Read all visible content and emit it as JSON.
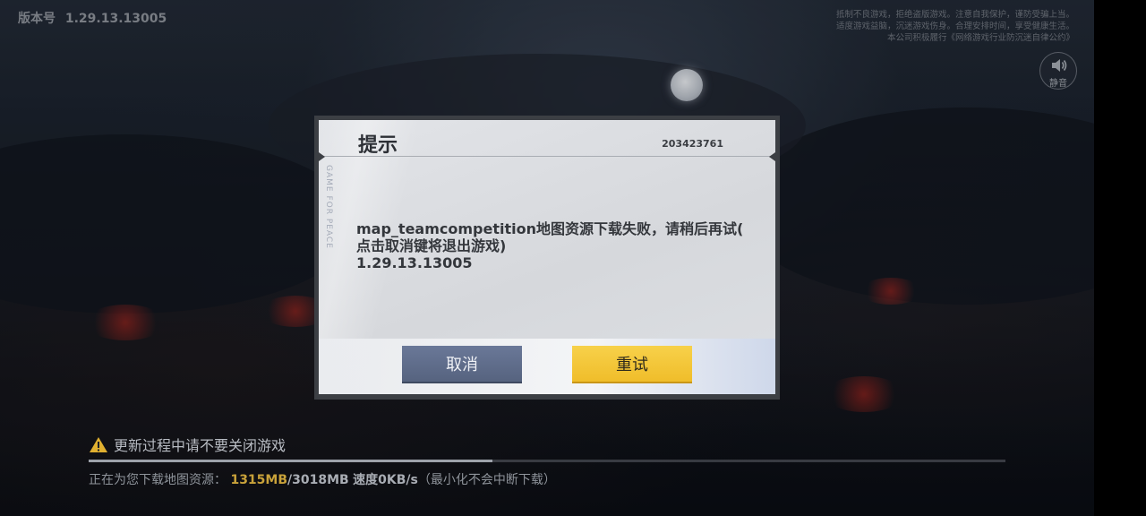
{
  "version_label": "版本号",
  "version_number": "1.29.13.13005",
  "notice_lines": [
    "抵制不良游戏，拒绝盗版游戏。注意自我保护，谨防受骗上当。",
    "适度游戏益脑，沉迷游戏伤身。合理安排时间，享受健康生活。",
    "本公司积极履行《网络游戏行业防沉迷自律公约》"
  ],
  "mute_button": {
    "label": "静音",
    "icon": "speaker-icon"
  },
  "dialog": {
    "title": "提示",
    "code": "203423761",
    "side_text": "GAME FOR PEACE",
    "message_lines": [
      "map_teamcompetition地图资源下载失败，请稍后再试(",
      "点击取消键将退出游戏)",
      "1.29.13.13005"
    ],
    "cancel_label": "取消",
    "retry_label": "重试"
  },
  "update_warning": {
    "icon": "warning-icon",
    "text": "更新过程中请不要关闭游戏"
  },
  "download": {
    "prefix": "正在为您下载地图资源：",
    "downloaded": "1315MB",
    "total": "/3018MB",
    "speed": "速度0KB/s",
    "note": "（最小化不会中断下载）",
    "progress_fraction": 0.44
  },
  "colors": {
    "retry_button": "#f0bd2a",
    "cancel_button": "#56637f",
    "downloaded_text": "#c9a23a",
    "warning_icon": "#e0b030"
  }
}
